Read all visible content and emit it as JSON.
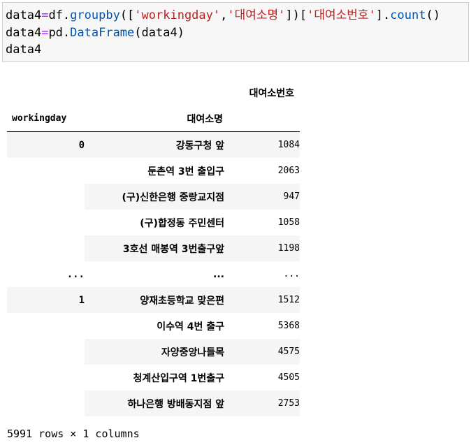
{
  "code": {
    "line1": {
      "var": "data4",
      "eq": "=",
      "obj": "df.",
      "fn_groupby": "groupby",
      "p1": "([",
      "s1": "'workingday'",
      "comma": ",",
      "s2": "'대여소명'",
      "p2": "])[",
      "s3": "'대여소번호'",
      "p3": "].",
      "fn_count": "count",
      "p4": "()"
    },
    "line2": {
      "var": "data4",
      "eq": "=",
      "obj": "pd.",
      "fn": "DataFrame",
      "args": "(data4)"
    },
    "line3": "data4"
  },
  "table": {
    "column_label": "대여소번호",
    "index_names": [
      "workingday",
      "대여소명"
    ],
    "rows": [
      {
        "l0": "0",
        "l1": "강동구청 앞",
        "v": "1084"
      },
      {
        "l0": "",
        "l1": "둔촌역 3번 출입구",
        "v": "2063"
      },
      {
        "l0": "",
        "l1": "(구)신한은행 중랑교지점",
        "v": "947"
      },
      {
        "l0": "",
        "l1": "(구)합정동 주민센터",
        "v": "1058"
      },
      {
        "l0": "",
        "l1": "3호선 매봉역 3번출구앞",
        "v": "1198"
      },
      {
        "l0": "...",
        "l1": "...",
        "v": "..."
      },
      {
        "l0": "1",
        "l1": "양재초등학교 맞은편",
        "v": "1512"
      },
      {
        "l0": "",
        "l1": "이수역 4번 출구",
        "v": "5368"
      },
      {
        "l0": "",
        "l1": "자양중앙나들목",
        "v": "4575"
      },
      {
        "l0": "",
        "l1": "청계산입구역 1번출구",
        "v": "4505"
      },
      {
        "l0": "",
        "l1": "하나은행 방배동지점 앞",
        "v": "2753"
      }
    ]
  },
  "footer": "5991 rows × 1 columns"
}
